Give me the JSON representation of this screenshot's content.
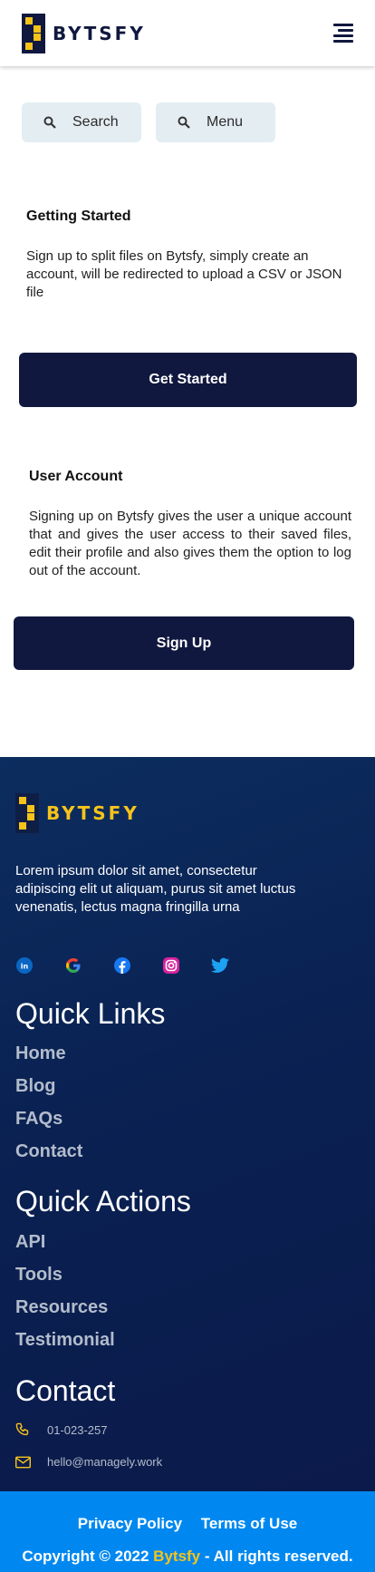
{
  "header": {
    "brand": "BYTSFY"
  },
  "quick_buttons": {
    "search_label": "Search",
    "menu_label": "Menu"
  },
  "getting_started": {
    "title": "Getting Started",
    "body": "Sign up to split files on Bytsfy, simply create an account,  will be redirected to upload a CSV or JSON file",
    "cta": "Get Started"
  },
  "user_account": {
    "title": "User Account",
    "body": "Signing up on Bytsfy gives the user a unique account that and gives the user access to their saved files, edit their profile and also gives them the option to log out of the account.",
    "cta": "Sign Up"
  },
  "footer": {
    "brand": "BYTSFY",
    "about": "Lorem ipsum dolor sit amet, consectetur adipiscing elit ut aliquam, purus sit amet luctus venenatis, lectus magna fringilla urna",
    "socials": [
      "linkedin-icon",
      "google-icon",
      "facebook-icon",
      "instagram-icon",
      "twitter-icon"
    ],
    "quick_links_title": "Quick Links",
    "quick_links": [
      "Home",
      "Blog",
      "FAQs",
      "Contact"
    ],
    "quick_actions_title": "Quick Actions",
    "quick_actions": [
      "API",
      "Tools",
      "Resources",
      "Testimonial"
    ],
    "contact_title": "Contact",
    "phone": "01-023-257",
    "email": "hello@managely.work"
  },
  "bottom_bar": {
    "privacy": "Privacy Policy",
    "terms": "Terms of Use",
    "copyright_prefix": "Copyright © 2022 ",
    "copyright_brand": "Bytsfy",
    "copyright_suffix": " - All rights reserved."
  },
  "colors": {
    "navy": "#10183f",
    "accent_yellow": "#f7c31a",
    "pill_bg": "#e4edf2",
    "footer_bg": "#0a2152",
    "bottom_blue": "#0088f0"
  }
}
